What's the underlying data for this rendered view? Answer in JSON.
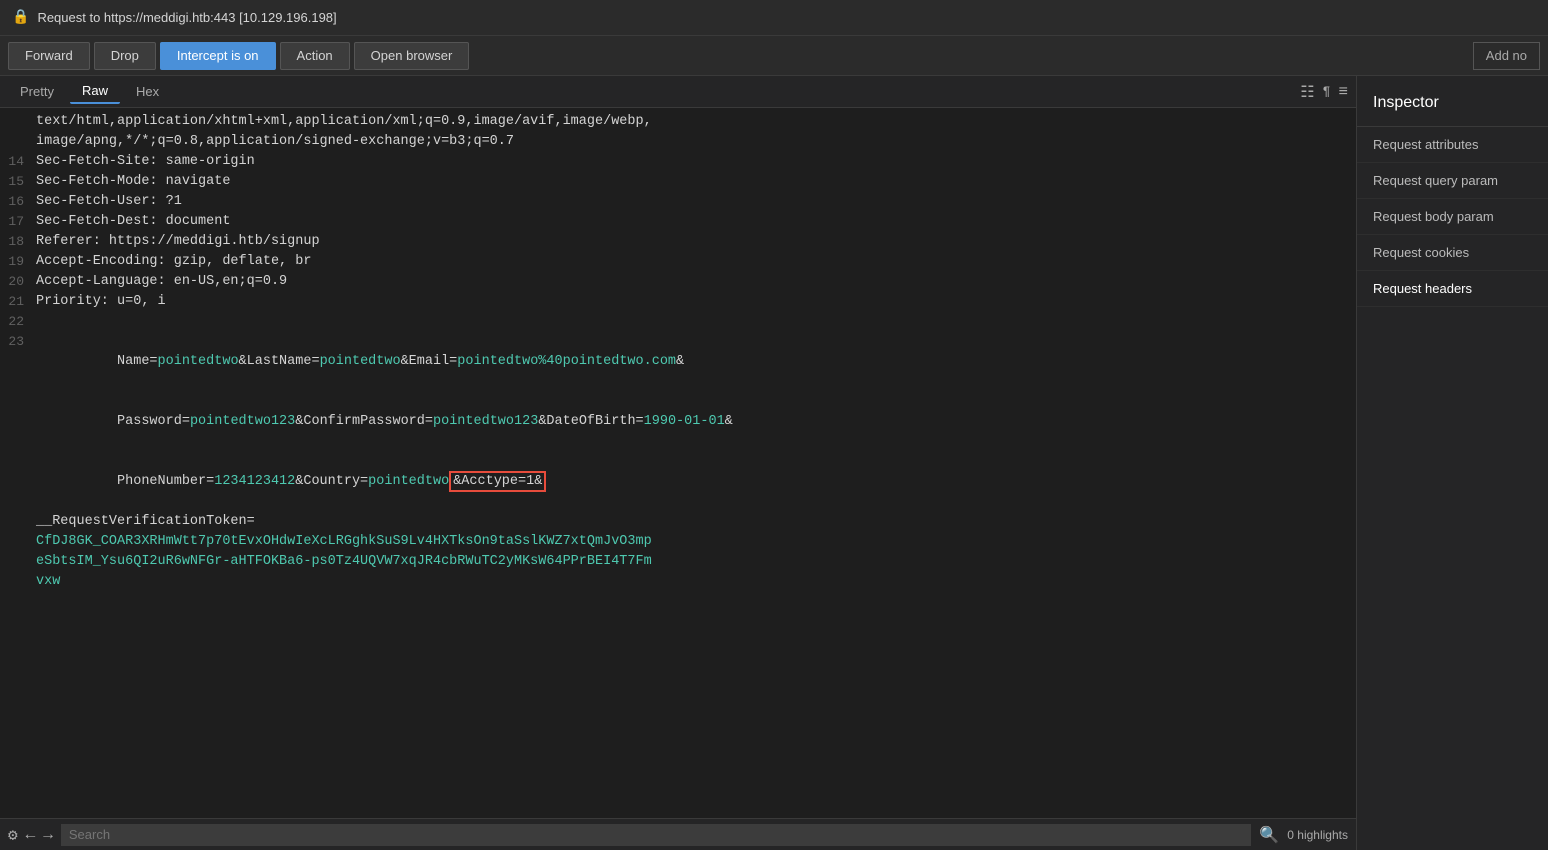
{
  "titleBar": {
    "lockIcon": "🔒",
    "text": "Request to https://meddigi.htb:443 [10.129.196.198]"
  },
  "toolbar": {
    "forwardLabel": "Forward",
    "dropLabel": "Drop",
    "interceptLabel": "Intercept is on",
    "actionLabel": "Action",
    "openBrowserLabel": "Open browser",
    "addNoteLabel": "Add no"
  },
  "tabs": {
    "pretty": "Pretty",
    "raw": "Raw",
    "hex": "Hex"
  },
  "codeLines": [
    {
      "num": "",
      "content": "text/html,application/xhtml+xml,application/xml;q=0.9,image/avif,image/webp,",
      "type": "plain"
    },
    {
      "num": "",
      "content": "image/apng,*/*;q=0.8,application/signed-exchange;v=b3;q=0.7",
      "type": "plain"
    },
    {
      "num": "14",
      "content": "Sec-Fetch-Site: same-origin",
      "type": "header"
    },
    {
      "num": "15",
      "content": "Sec-Fetch-Mode: navigate",
      "type": "header"
    },
    {
      "num": "16",
      "content": "Sec-Fetch-User: ?1",
      "type": "header"
    },
    {
      "num": "17",
      "content": "Sec-Fetch-Dest: document",
      "type": "header"
    },
    {
      "num": "18",
      "content": "Referer: https://meddigi.htb/signup",
      "type": "header"
    },
    {
      "num": "19",
      "content": "Accept-Encoding: gzip, deflate, br",
      "type": "header"
    },
    {
      "num": "20",
      "content": "Accept-Language: en-US,en;q=0.9",
      "type": "header"
    },
    {
      "num": "21",
      "content": "Priority: u=0, i",
      "type": "header"
    },
    {
      "num": "22",
      "content": "",
      "type": "plain"
    },
    {
      "num": "23",
      "content": "PARAMS_LINE",
      "type": "params"
    }
  ],
  "paramsData": {
    "line1_pre": "Name=",
    "line1_v1": "pointedtwo",
    "line1_m1": "&LastName=",
    "line1_v2": "pointedtwo",
    "line1_m2": "&Email=",
    "line1_v3": "pointedtwo%40pointedtwo.com",
    "line1_m3": "&",
    "line2_pre": "Password=",
    "line2_v1": "pointedtwo123",
    "line2_m1": "&ConfirmPassword=",
    "line2_v2": "pointedtwo123",
    "line2_m2": "&DateOfBirth=",
    "line2_v3": "1990-01-01",
    "line2_m3": "&",
    "line3_pre": "PhoneNumber=",
    "line3_v1": "1234123412",
    "line3_m1": "&Country=",
    "line3_v2": "pointedtwo",
    "line3_highlighted": "&Acctype=1&",
    "line4_pre": "__RequestVerificationToken=",
    "line5_v1": "CfDJ8GK_COAR3XRHmWtt7p70tEvxOHdwIeXcLRGghkSuS9Lv4HXTksOn9taSslKWZ7xtQmJvO3mp",
    "line6_v1": "eSbtsIM_Ysu6QI2uR6wNFGr-aHTFOKBa6-ps0Tz4UQVW7xqJR4cbRWuTC2yMKsW64PPrBEI4T7Fm",
    "line7_v1": "vxw"
  },
  "inspector": {
    "title": "Inspector",
    "items": [
      "Request attributes",
      "Request query param",
      "Request body param",
      "Request cookies",
      "Request headers"
    ]
  },
  "bottomBar": {
    "searchPlaceholder": "Search",
    "highlightCount": "0 highlights"
  }
}
